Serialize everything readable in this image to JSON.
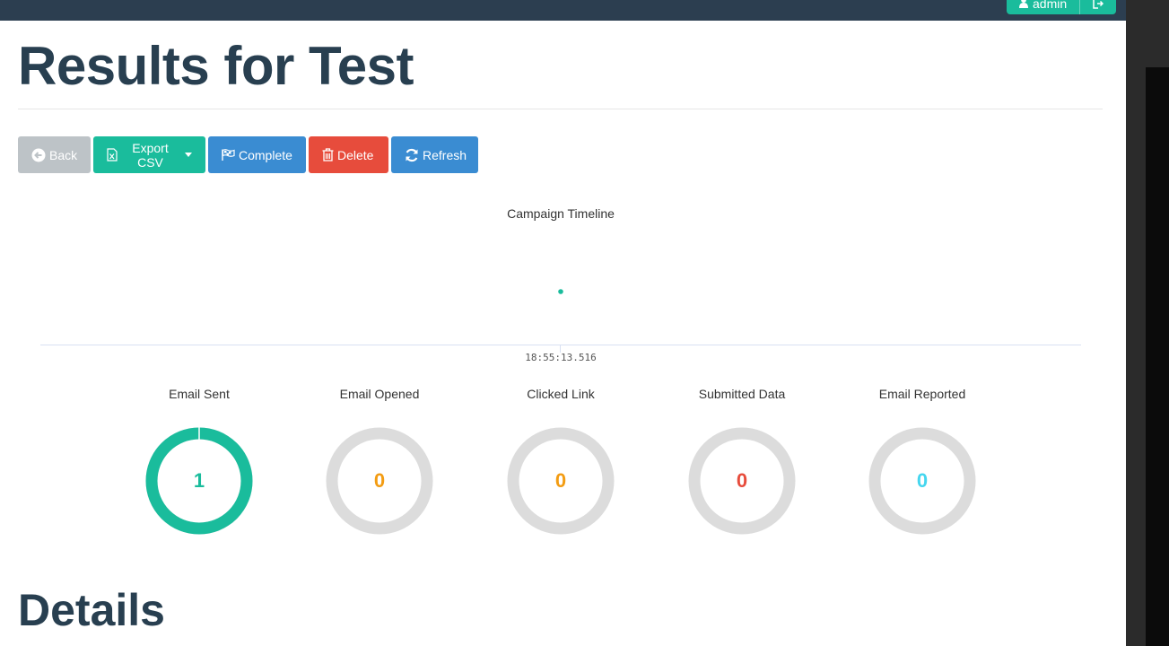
{
  "nav": {
    "user_label": "admin",
    "user_icon": "user-icon",
    "logout_icon": "logout-icon"
  },
  "page": {
    "title": "Results for Test",
    "details_heading": "Details"
  },
  "toolbar": {
    "back_label": "Back",
    "export_label": "Export CSV",
    "complete_label": "Complete",
    "delete_label": "Delete",
    "refresh_label": "Refresh"
  },
  "timeline": {
    "title": "Campaign Timeline",
    "tick_label": "18:55:13.516",
    "event_color": "#1abc9c"
  },
  "stats": [
    {
      "label": "Email Sent",
      "value": "1",
      "fraction": 1.0,
      "color": "#1abc9c"
    },
    {
      "label": "Email Opened",
      "value": "0",
      "fraction": 0,
      "color": "#f39c12"
    },
    {
      "label": "Clicked Link",
      "value": "0",
      "fraction": 0,
      "color": "#f39c12"
    },
    {
      "label": "Submitted Data",
      "value": "0",
      "fraction": 0,
      "color": "#e74c3c"
    },
    {
      "label": "Email Reported",
      "value": "0",
      "fraction": 0,
      "color": "#45d6ef"
    }
  ]
}
